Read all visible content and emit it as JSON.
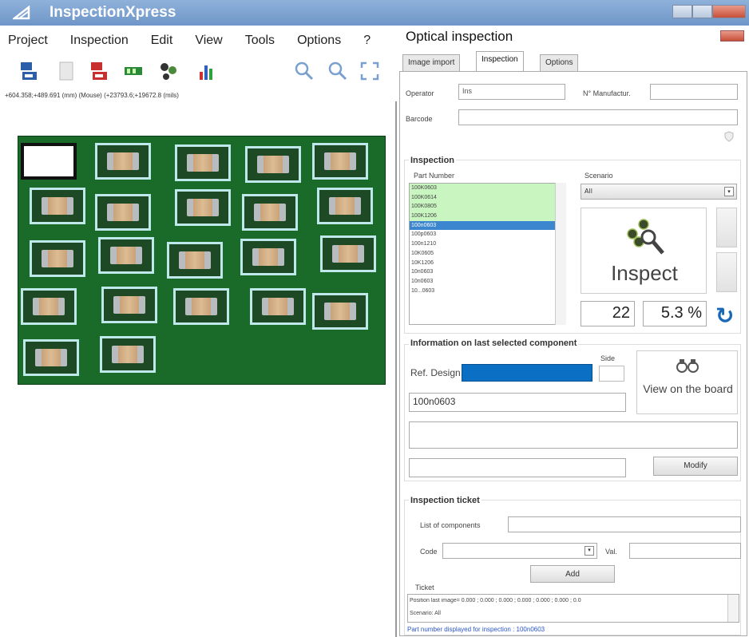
{
  "app": {
    "title": "InspectionXpress",
    "menu": [
      "Project",
      "Inspection",
      "Edit",
      "View",
      "Tools",
      "Options",
      "?"
    ],
    "coords": "+604.358;+489.691 (mm) (Mouse) (+23793.6;+19672.8 (mils)"
  },
  "panel": {
    "title": "Optical inspection",
    "tabs": [
      "Image import",
      "Inspection",
      "Options"
    ],
    "active_tab": "Inspection",
    "operator_label": "Operator",
    "operator_value": "Ins",
    "manufacturer_label": "N° Manufactur.",
    "manufacturer_value": "",
    "barcode_label": "Barcode",
    "barcode_value": "",
    "inspection_title": "Inspection",
    "part_number_label": "Part Number",
    "scenario_label": "Scenario",
    "scenario_value": "All",
    "part_numbers": [
      {
        "label": "100K0603",
        "state": "ok"
      },
      {
        "label": "100K0614",
        "state": "ok"
      },
      {
        "label": "100K0805",
        "state": "ok"
      },
      {
        "label": "100K1206",
        "state": "ok"
      },
      {
        "label": "100n0603",
        "state": "sel"
      },
      {
        "label": "100p0603",
        "state": ""
      },
      {
        "label": "100n1210",
        "state": ""
      },
      {
        "label": "10K0605",
        "state": ""
      },
      {
        "label": "10K1206",
        "state": ""
      },
      {
        "label": "10n0603",
        "state": ""
      },
      {
        "label": "10n0603",
        "state": ""
      },
      {
        "label": "10...0603",
        "state": ""
      }
    ],
    "inspect_label": "Inspect",
    "count": "22",
    "percent": "5.3 %",
    "info_title": "Information on last selected component",
    "side_label": "Side",
    "ref_design_label": "Ref. Design.",
    "part_value": "100n0603",
    "view_board_label": "View on the board",
    "modify_label": "Modify",
    "ticket_title": "Inspection ticket",
    "list_components_label": "List of components",
    "code_label": "Code",
    "val_label": "Val.",
    "add_label": "Add",
    "ticket_label": "Ticket",
    "ticket_line1": "Position last image= 0.000 ; 0.000 ; 0.000 ; 0.000 ; 0.000 ; 0.000 ; 0.0",
    "ticket_line2": "Scenario: All",
    "status": "Part number displayed for inspection : 100n0603"
  },
  "colors": {
    "accent": "#0b6fc4",
    "pcb": "#1a6b2a",
    "ok_row": "#c8f5c0",
    "selected_row": "#3c86d0"
  }
}
